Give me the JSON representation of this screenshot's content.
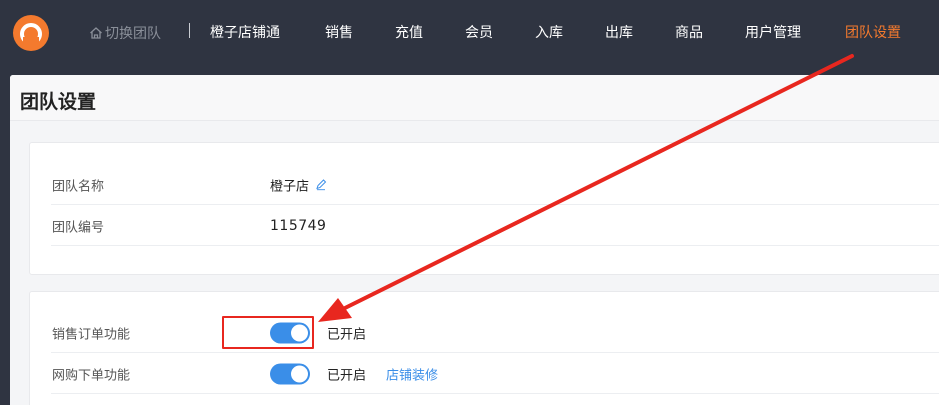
{
  "nav": {
    "switch_team": "切换团队",
    "items": [
      {
        "label": "橙子店铺通",
        "active": false
      },
      {
        "label": "销售",
        "active": false
      },
      {
        "label": "充值",
        "active": false
      },
      {
        "label": "会员",
        "active": false
      },
      {
        "label": "入库",
        "active": false
      },
      {
        "label": "出库",
        "active": false
      },
      {
        "label": "商品",
        "active": false
      },
      {
        "label": "用户管理",
        "active": false
      },
      {
        "label": "团队设置",
        "active": true
      }
    ]
  },
  "page": {
    "title": "团队设置"
  },
  "team_info": {
    "name_label": "团队名称",
    "name_value": "橙子店",
    "id_label": "团队编号",
    "id_value": "115749"
  },
  "features": {
    "sales_order": {
      "label": "销售订单功能",
      "enabled": true,
      "status": "已开启"
    },
    "online_order": {
      "label": "网购下单功能",
      "enabled": true,
      "status": "已开启",
      "link": "店铺装修"
    }
  },
  "colors": {
    "nav_bg": "#2f3441",
    "accent_orange": "#f47a2e",
    "toggle_blue": "#3a8ee8",
    "annotation_red": "#e8271f"
  }
}
